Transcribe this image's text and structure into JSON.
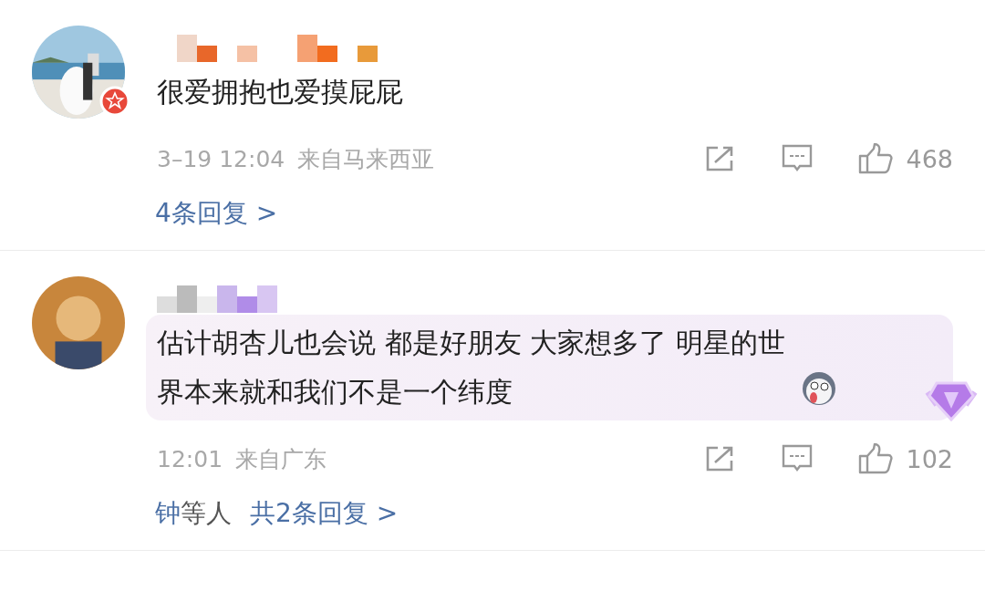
{
  "comments": [
    {
      "text": "很爱拥抱也爱摸屁屁",
      "emoji": false,
      "highlighted": false,
      "verified": true,
      "time": "3–19 12:04",
      "location": "来自马来西亚",
      "likes": "468",
      "replies": {
        "count": "4条回复 >"
      }
    },
    {
      "avatar": {
        "kind": "plain"
      },
      "text": "估计胡杏儿也会说 都是好朋友 大家想多了  明星的世界本来就和我们不是一个纬度",
      "emoji": true,
      "highlighted": true,
      "verified": false,
      "time": "12:01",
      "location": "来自广东",
      "likes": "102",
      "replies": {
        "names": "钟",
        "suffix": "等人",
        "count": "共2条回复 >"
      }
    }
  ]
}
